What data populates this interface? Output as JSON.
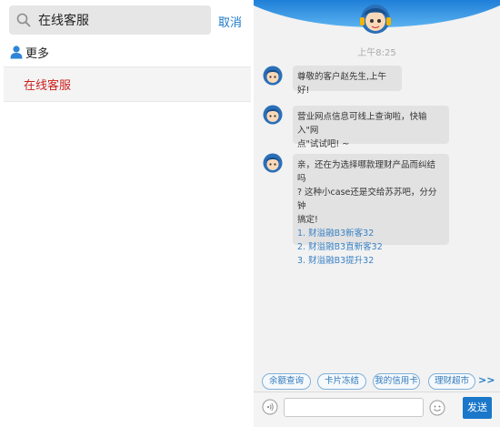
{
  "search": {
    "query": "在线客服",
    "cancel_label": "取消",
    "more_label": "更多",
    "results": [
      {
        "label": "在线客服"
      }
    ]
  },
  "chat": {
    "timestamp": "上午8:25",
    "messages": [
      {
        "lines": [
          "尊敬的客户赵先生,上午好!"
        ]
      },
      {
        "lines": [
          "营业网点信息可线上查询啦，快输入\"网",
          "点\"试试吧! ~"
        ]
      },
      {
        "lines": [
          "亲，还在为选择哪款理财产品而纠结吗",
          "? 这种小case还是交给苏苏吧，分分钟",
          "搞定!"
        ],
        "links": [
          "1. 财溢融B3新客32",
          "2. 财溢融B3直新客32",
          "3. 财溢融B3提升32"
        ]
      }
    ],
    "quick_replies": [
      "余额查询",
      "卡片冻结",
      "我的信用卡",
      "理财超市"
    ],
    "quick_more": ">>",
    "input_value": "",
    "send_label": "发送"
  },
  "colors": {
    "accent_blue": "#1a77c9",
    "result_red": "#c8211f",
    "header_blue": "#2c8de0"
  },
  "icons": [
    "search-icon",
    "user-icon",
    "robot-avatar-icon",
    "voice-icon",
    "emoji-icon"
  ]
}
